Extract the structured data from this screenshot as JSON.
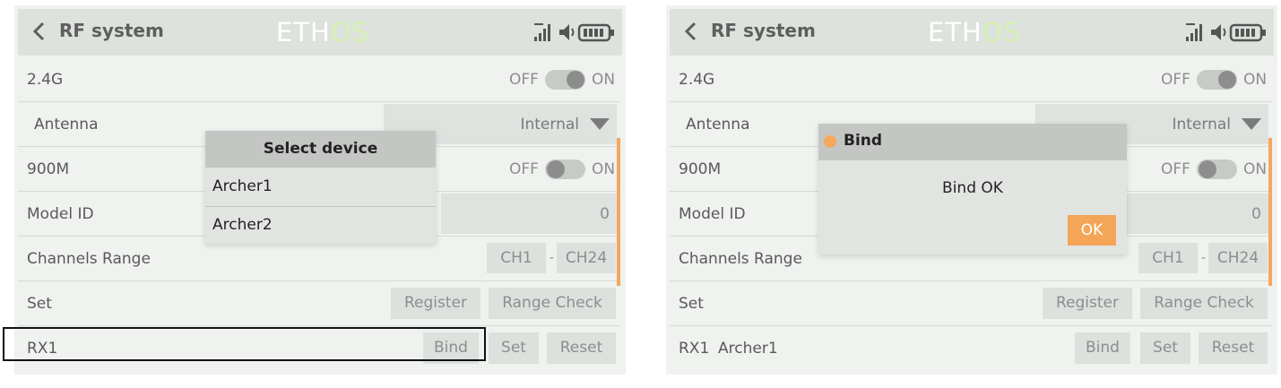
{
  "panels": {
    "left": {
      "header": {
        "title": "RF system",
        "logo_a": "ETH",
        "logo_b": "OS"
      },
      "rows": {
        "r24g": {
          "label": "2.4G",
          "off": "OFF",
          "on": "ON"
        },
        "antenna": {
          "label": "Antenna",
          "value": "Internal"
        },
        "m900": {
          "label": "900M",
          "off": "OFF",
          "on": "ON"
        },
        "model_id": {
          "label": "Model ID",
          "value": "0"
        },
        "channels_range": {
          "label": "Channels Range",
          "start": "CH1",
          "dash": "-",
          "end": "CH24"
        },
        "set": {
          "label": "Set",
          "register": "Register",
          "range_check": "Range Check"
        },
        "rx1": {
          "label": "RX1",
          "receiver": "",
          "bind": "Bind",
          "set": "Set",
          "reset": "Reset"
        }
      },
      "popup": {
        "title": "Select device",
        "items": [
          "Archer1",
          "Archer2"
        ]
      }
    },
    "right": {
      "header": {
        "title": "RF system",
        "logo_a": "ETH",
        "logo_b": "OS"
      },
      "rows": {
        "r24g": {
          "label": "2.4G",
          "off": "OFF",
          "on": "ON"
        },
        "antenna": {
          "label": "Antenna",
          "value": "Internal"
        },
        "m900": {
          "label": "900M",
          "off": "OFF",
          "on": "ON"
        },
        "model_id": {
          "label": "Model ID",
          "value": "0"
        },
        "channels_range": {
          "label": "Channels Range",
          "start": "CH1",
          "dash": "-",
          "end": "CH24"
        },
        "set": {
          "label": "Set",
          "register": "Register",
          "range_check": "Range Check"
        },
        "rx1": {
          "label": "RX1",
          "receiver": "Archer1",
          "bind": "Bind",
          "set": "Set",
          "reset": "Reset"
        }
      },
      "dialog": {
        "title": "Bind",
        "message": "Bind OK",
        "ok": "OK"
      }
    }
  },
  "colors": {
    "accent": "#f4a557",
    "panel_bg": "#eff2ef",
    "header_bg": "#dde2dd",
    "button_bg": "#dde1dd",
    "logo_accent": "#d6f2b2"
  },
  "icons": [
    "back-chevron-icon",
    "rf-signal-icon",
    "speaker-icon",
    "battery-icon",
    "dropdown-arrow-icon"
  ]
}
